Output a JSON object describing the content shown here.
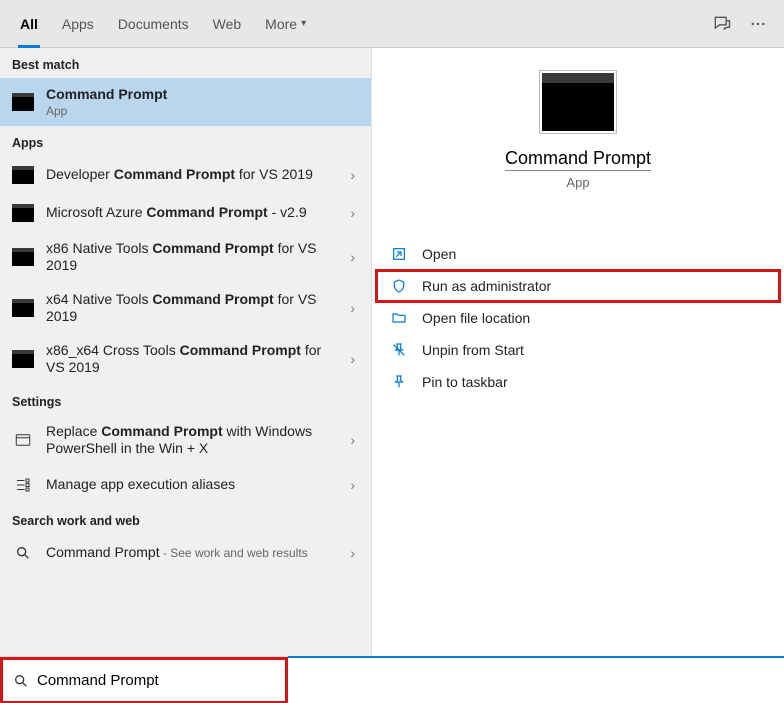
{
  "tabs": {
    "all": "All",
    "apps": "Apps",
    "documents": "Documents",
    "web": "Web",
    "more": "More"
  },
  "sections": {
    "best_match": "Best match",
    "apps": "Apps",
    "settings": "Settings",
    "search_work_web": "Search work and web"
  },
  "best_match": {
    "title": "Command Prompt",
    "subtitle": "App"
  },
  "app_results": [
    {
      "pre": "Developer ",
      "bold": "Command Prompt",
      "post": " for VS 2019"
    },
    {
      "pre": "Microsoft Azure ",
      "bold": "Command Prompt",
      "post": " - v2.9"
    },
    {
      "pre": "x86 Native Tools ",
      "bold": "Command Prompt",
      "post": " for VS 2019"
    },
    {
      "pre": "x64 Native Tools ",
      "bold": "Command Prompt",
      "post": " for VS 2019"
    },
    {
      "pre": "x86_x64 Cross Tools ",
      "bold": "Command Prompt",
      "post": " for VS 2019"
    }
  ],
  "settings_results": [
    {
      "pre": "Replace ",
      "bold": "Command Prompt",
      "post": " with Windows PowerShell in the Win + X"
    },
    {
      "pre": "",
      "bold": "",
      "post": "Manage app execution aliases"
    }
  ],
  "web_result": {
    "title": "Command Prompt",
    "hint": " - See work and web results"
  },
  "detail": {
    "title": "Command Prompt",
    "subtitle": "App"
  },
  "actions": {
    "open": "Open",
    "run_admin": "Run as administrator",
    "open_loc": "Open file location",
    "unpin_start": "Unpin from Start",
    "pin_taskbar": "Pin to taskbar"
  },
  "search": {
    "value": "Command Prompt"
  }
}
